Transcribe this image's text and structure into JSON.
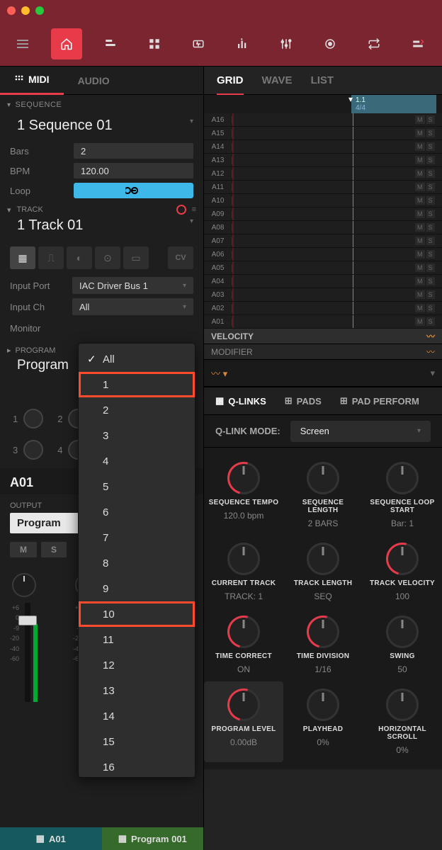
{
  "titlebar": {},
  "toolbar": {
    "items": [
      "menu",
      "home",
      "browser",
      "pads",
      "sampler",
      "levels",
      "mixer",
      "record",
      "loop",
      "tools"
    ]
  },
  "left": {
    "tabs": {
      "midi": "MIDI",
      "audio": "AUDIO"
    },
    "sequence": {
      "header": "SEQUENCE",
      "name": "1 Sequence 01",
      "bars_label": "Bars",
      "bars_value": "2",
      "bpm_label": "BPM",
      "bpm_value": "120.00",
      "loop_label": "Loop"
    },
    "track": {
      "header": "TRACK",
      "name": "1 Track 01",
      "input_port_label": "Input Port",
      "input_port_value": "IAC Driver Bus 1",
      "input_ch_label": "Input Ch",
      "input_ch_value": "All",
      "monitor_label": "Monitor"
    },
    "program": {
      "header": "PROGRAM",
      "name": "Program"
    },
    "knob_nums": [
      "1",
      "2",
      "3",
      "4"
    ],
    "pad": "A01",
    "output_label": "OUTPUT",
    "output_value": "Program",
    "ms": {
      "m": "M",
      "s": "S"
    },
    "scale": [
      "+6",
      "0",
      "-9",
      "-20",
      "-40",
      "-60"
    ],
    "footer": {
      "a": "A01",
      "b": "Program 001"
    }
  },
  "dropdown": {
    "items": [
      "All",
      "1",
      "2",
      "3",
      "4",
      "5",
      "6",
      "7",
      "8",
      "9",
      "10",
      "11",
      "12",
      "13",
      "14",
      "15",
      "16"
    ],
    "checked": "All",
    "highlight": [
      "1",
      "10"
    ]
  },
  "right": {
    "tabs": {
      "grid": "GRID",
      "wave": "WAVE",
      "list": "LIST"
    },
    "marker": {
      "pos": "1.1",
      "sig": "4/4"
    },
    "rows": [
      "A16",
      "A15",
      "A14",
      "A13",
      "A12",
      "A11",
      "A10",
      "A09",
      "A08",
      "A07",
      "A06",
      "A05",
      "A04",
      "A03",
      "A02",
      "A01"
    ],
    "velocity": "VELOCITY",
    "modifier": "MODIFIER",
    "qtabs": {
      "qlinks": "Q-LINKS",
      "pads": "PADS",
      "padperf": "PAD PERFORM"
    },
    "qlm_label": "Q-LINK MODE:",
    "qlm_value": "Screen",
    "knobs": [
      [
        {
          "t": "SEQUENCE TEMPO",
          "v": "120.0 bpm",
          "red": true
        },
        {
          "t": "SEQUENCE LENGTH",
          "v": "2 BARS"
        },
        {
          "t": "SEQUENCE LOOP START",
          "v": "Bar: 1"
        }
      ],
      [
        {
          "t": "CURRENT TRACK",
          "v": "TRACK: 1"
        },
        {
          "t": "TRACK LENGTH",
          "v": "SEQ"
        },
        {
          "t": "TRACK VELOCITY",
          "v": "100",
          "red": true
        }
      ],
      [
        {
          "t": "TIME CORRECT",
          "v": "ON",
          "red": true
        },
        {
          "t": "TIME DIVISION",
          "v": "1/16",
          "red": true
        },
        {
          "t": "SWING",
          "v": "50"
        }
      ],
      [
        {
          "t": "PROGRAM LEVEL",
          "v": "0.00dB",
          "red": true,
          "sel": true
        },
        {
          "t": "PLAYHEAD",
          "v": "0%"
        },
        {
          "t": "HORIZONTAL SCROLL",
          "v": "0%"
        }
      ]
    ]
  }
}
